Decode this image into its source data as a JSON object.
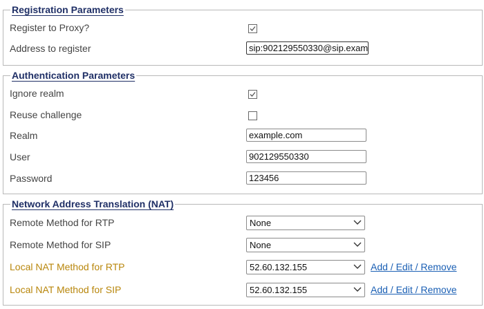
{
  "registration": {
    "title": "Registration Parameters",
    "register_to_proxy_label": "Register to Proxy?",
    "register_to_proxy_checked": true,
    "address_label": "Address to register",
    "address_value": "sip:902129550330@sip.exam"
  },
  "authentication": {
    "title": "Authentication Parameters",
    "ignore_realm_label": "Ignore realm",
    "ignore_realm_checked": true,
    "reuse_challenge_label": "Reuse challenge",
    "reuse_challenge_checked": false,
    "realm_label": "Realm",
    "realm_value": "example.com",
    "user_label": "User",
    "user_value": "902129550330",
    "password_label": "Password",
    "password_value": "123456"
  },
  "nat": {
    "title": "Network Address Translation (NAT)",
    "remote_rtp_label": "Remote Method for RTP",
    "remote_rtp_value": "None",
    "remote_sip_label": "Remote Method for SIP",
    "remote_sip_value": "None",
    "local_rtp_label": "Local NAT Method for RTP",
    "local_rtp_value": "52.60.132.155",
    "local_rtp_link": "Add / Edit / Remove",
    "local_sip_label": "Local NAT Method for SIP",
    "local_sip_value": "52.60.132.155",
    "local_sip_link": "Add / Edit / Remove"
  },
  "colors": {
    "legend": "#1f2f66",
    "label": "#444444",
    "nat_local_label": "#b8860b",
    "link": "#1a5fb4"
  }
}
